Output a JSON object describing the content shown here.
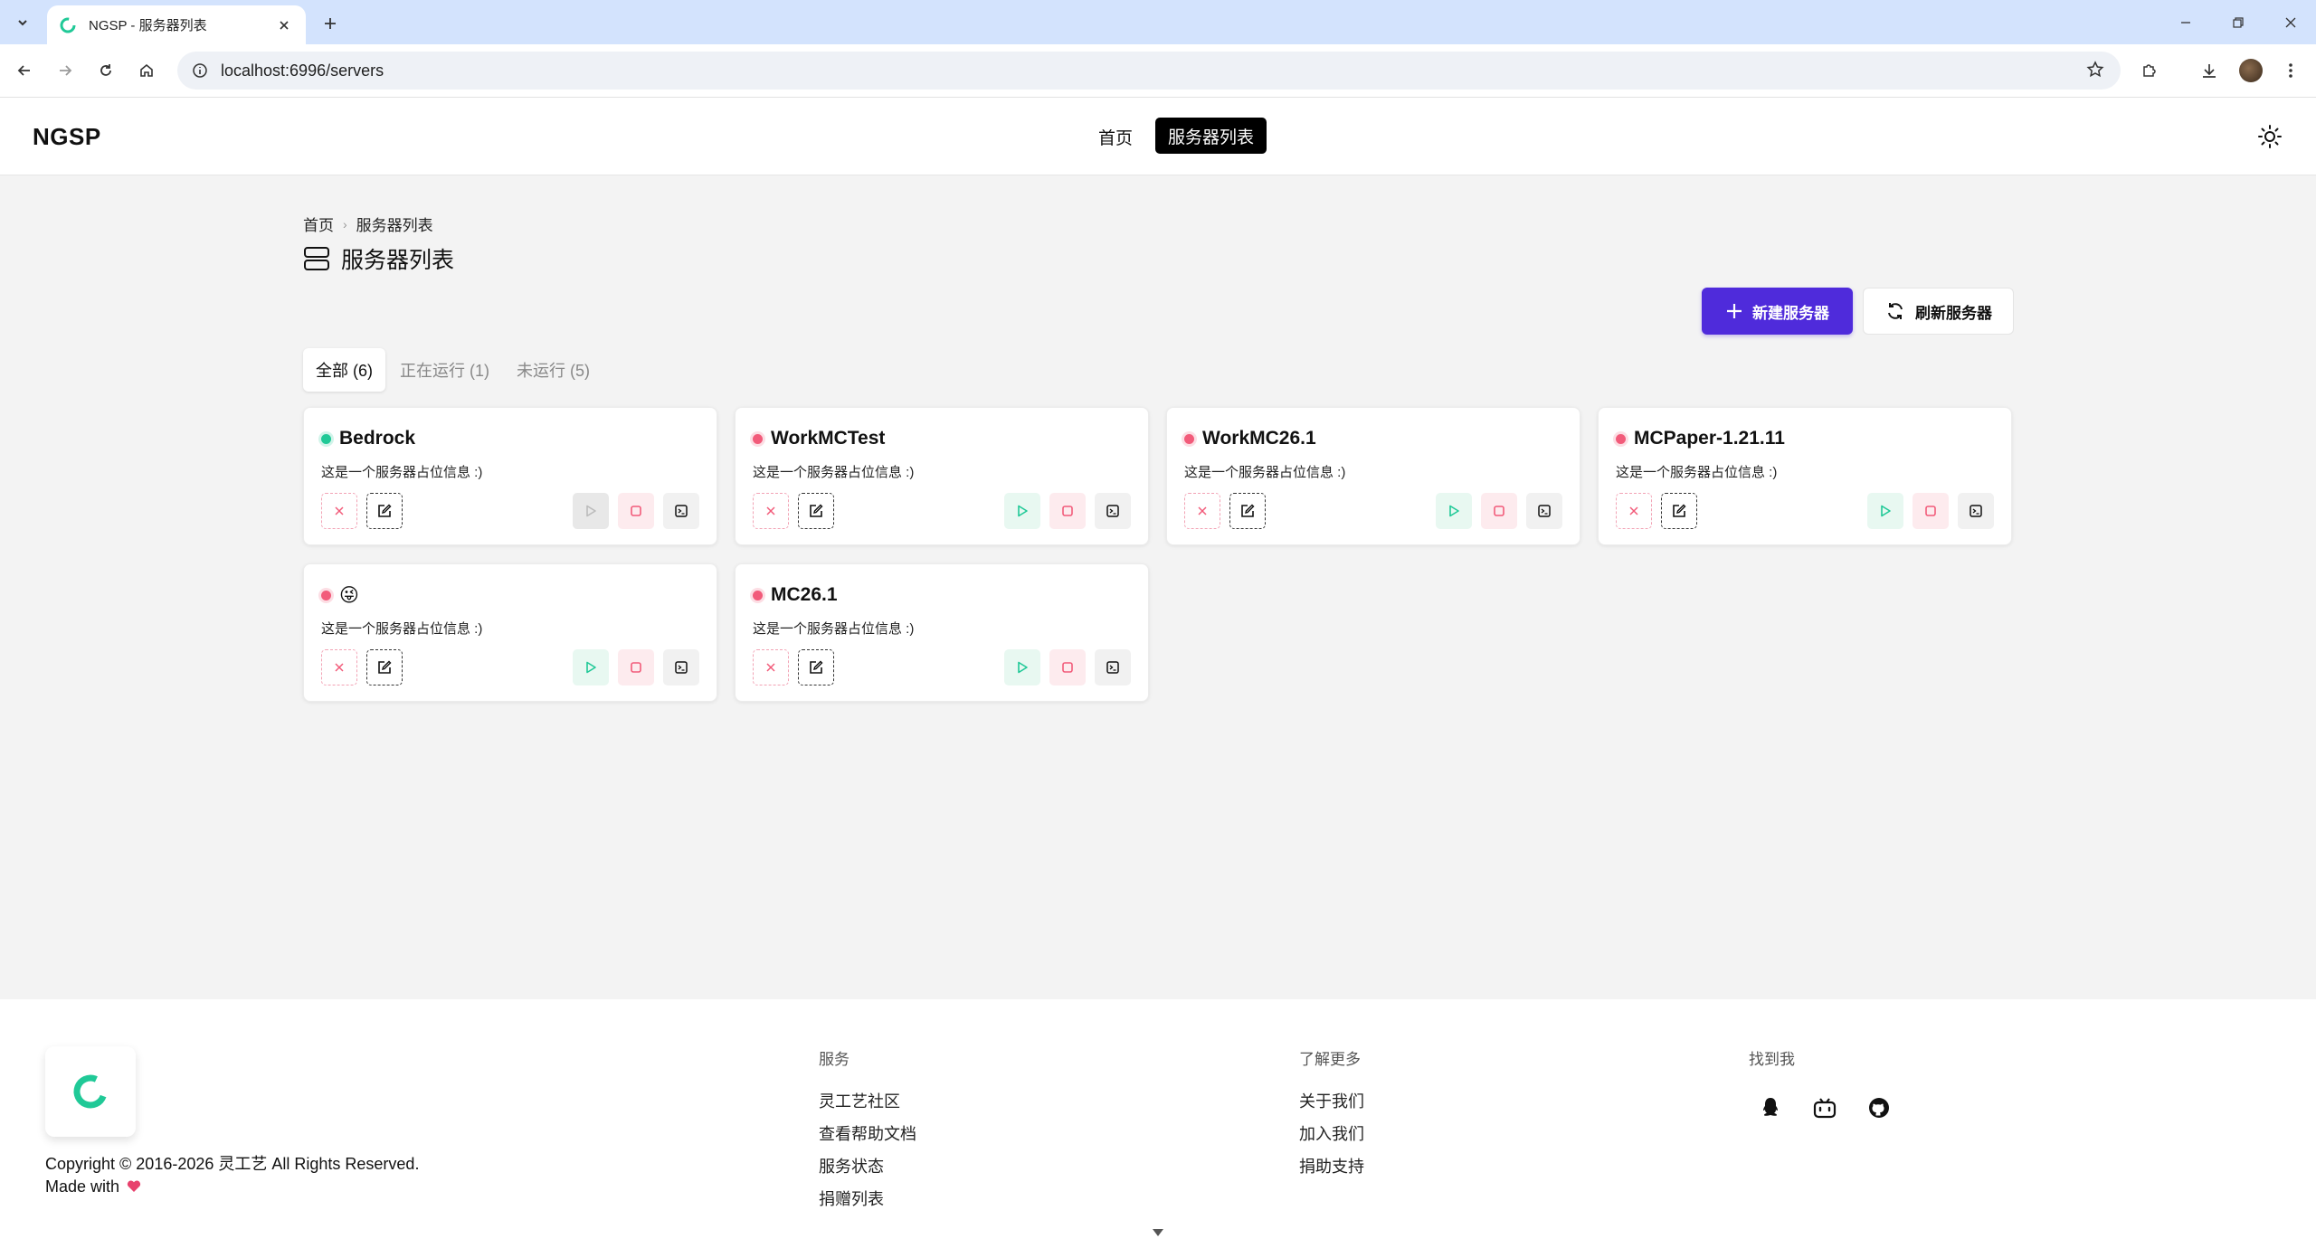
{
  "browser": {
    "tab_title": "NGSP - 服务器列表",
    "url": "localhost:6996/servers"
  },
  "header": {
    "brand": "NGSP",
    "nav": [
      {
        "label": "首页",
        "active": false
      },
      {
        "label": "服务器列表",
        "active": true
      }
    ]
  },
  "breadcrumb": [
    "首页",
    "服务器列表"
  ],
  "page": {
    "title": "服务器列表",
    "new_button": "新建服务器",
    "refresh_button": "刷新服务器"
  },
  "filters": [
    {
      "label": "全部 (6)",
      "active": true
    },
    {
      "label": "正在运行 (1)",
      "active": false
    },
    {
      "label": "未运行 (5)",
      "active": false
    }
  ],
  "servers": [
    {
      "name": "Bedrock",
      "desc": "这是一个服务器占位信息 :)",
      "running": true
    },
    {
      "name": "WorkMCTest",
      "desc": "这是一个服务器占位信息 :)",
      "running": false
    },
    {
      "name": "WorkMC26.1",
      "desc": "这是一个服务器占位信息 :)",
      "running": false
    },
    {
      "name": "MCPaper-1.21.11",
      "desc": "这是一个服务器占位信息 :)",
      "running": false
    },
    {
      "name": "😜",
      "desc": "这是一个服务器占位信息 :)",
      "running": false
    },
    {
      "name": "MC26.1",
      "desc": "这是一个服务器占位信息 :)",
      "running": false
    }
  ],
  "footer": {
    "copyright": "Copyright © 2016-2026 灵工艺 All Rights Reserved.",
    "made_with": "Made with",
    "columns": [
      {
        "heading": "服务",
        "links": [
          "灵工艺社区",
          "查看帮助文档",
          "服务状态",
          "捐赠列表"
        ]
      },
      {
        "heading": "了解更多",
        "links": [
          "关于我们",
          "加入我们",
          "捐助支持"
        ]
      },
      {
        "heading": "找到我",
        "links": []
      }
    ],
    "social_icons": [
      "qq-icon",
      "bilibili-icon",
      "github-icon"
    ]
  },
  "colors": {
    "accent": "#4f2bdb",
    "running": "#20c997",
    "stopped": "#f25b7a"
  }
}
